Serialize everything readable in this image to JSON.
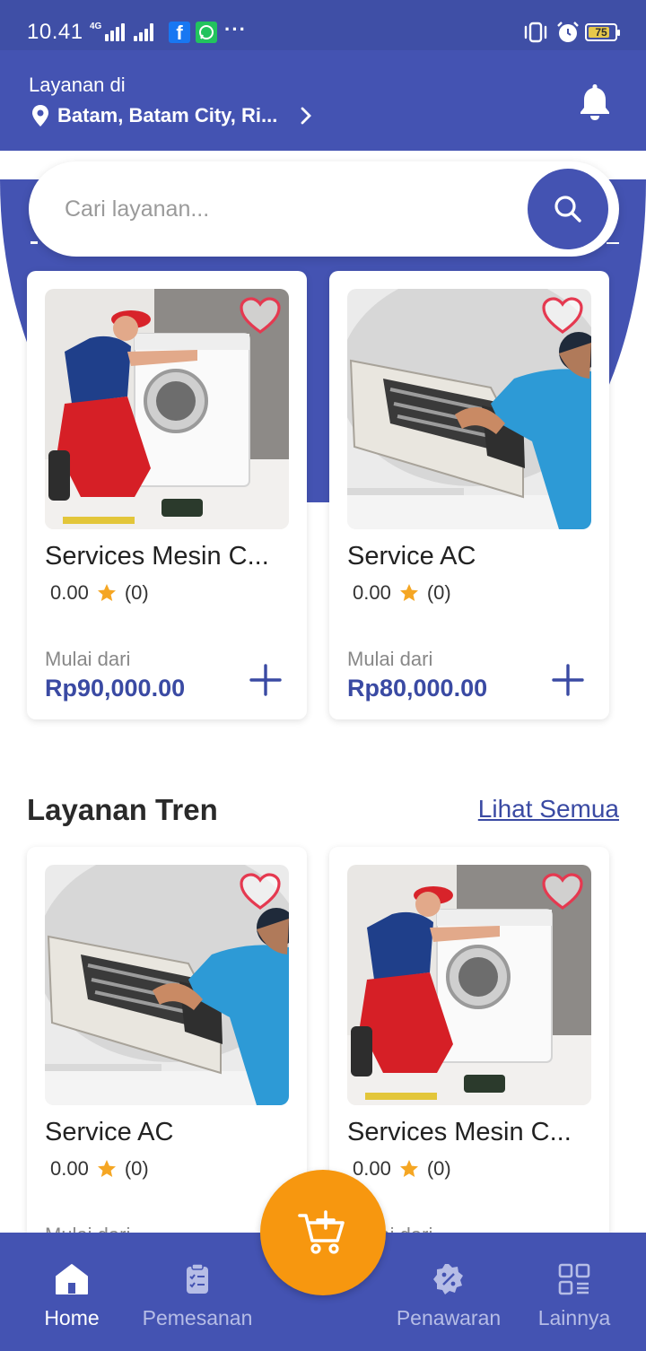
{
  "status_bar": {
    "time": "10.41",
    "network": "4G",
    "battery": "75"
  },
  "header": {
    "label": "Layanan di",
    "location": "Batam, Batam City, Ri..."
  },
  "search": {
    "placeholder": "Cari layanan..."
  },
  "featured": [
    {
      "title": "Services Mesin C...",
      "rating": "0.00",
      "reviews": "(0)",
      "from_label": "Mulai dari",
      "price": "Rp90,000.00",
      "image": "washing-machine-technician"
    },
    {
      "title": "Service AC",
      "rating": "0.00",
      "reviews": "(0)",
      "from_label": "Mulai dari",
      "price": "Rp80,000.00",
      "image": "ac-technician"
    }
  ],
  "trending": {
    "title": "Layanan Tren",
    "see_all": "Lihat Semua",
    "items": [
      {
        "title": "Service AC",
        "rating": "0.00",
        "reviews": "(0)",
        "from_label": "Mulai dari",
        "image": "ac-technician"
      },
      {
        "title": "Services Mesin C...",
        "rating": "0.00",
        "reviews": "(0)",
        "from_label": "Mulai dari",
        "image": "washing-machine-technician"
      }
    ]
  },
  "bottom_nav": {
    "home": "Home",
    "orders": "Pemesanan",
    "offers": "Penawaran",
    "more": "Lainnya"
  },
  "colors": {
    "primary": "#4453b2",
    "accent": "#f7970f",
    "star": "#f5a623",
    "price": "#3a4aa3"
  }
}
